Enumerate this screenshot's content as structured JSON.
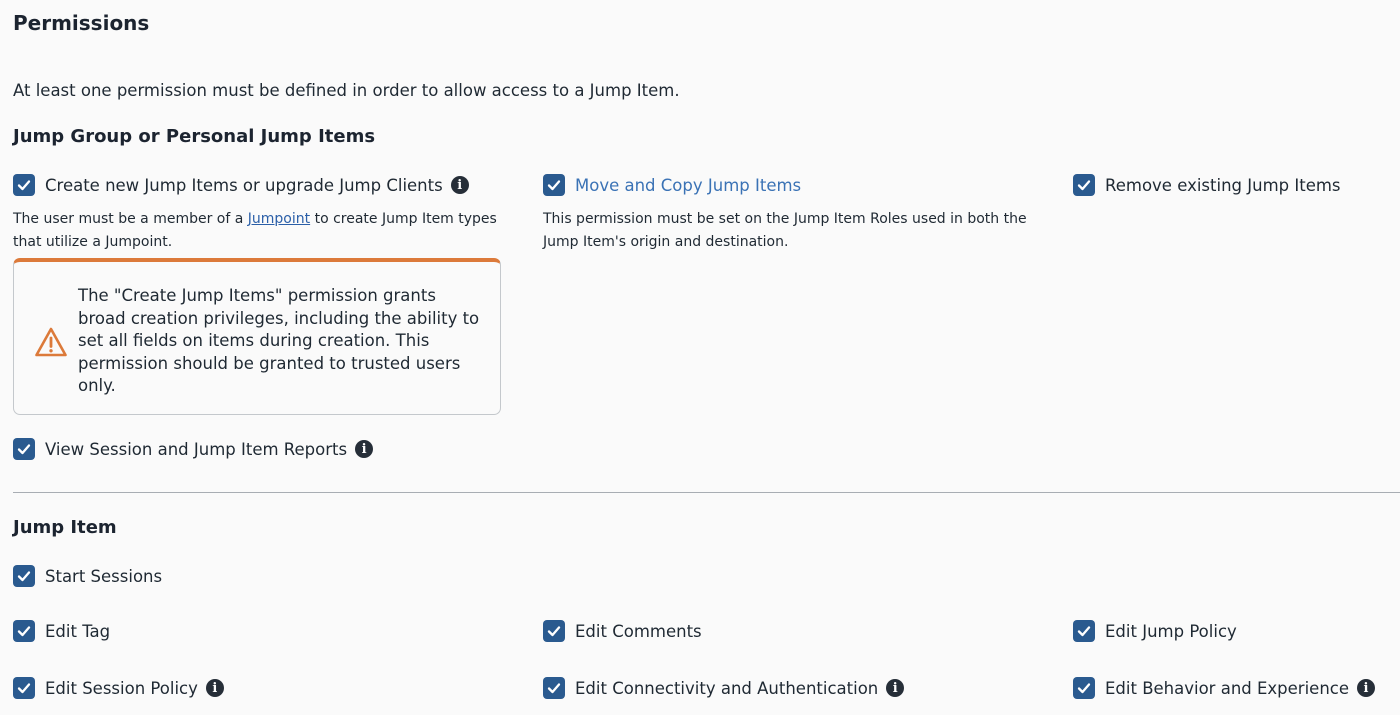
{
  "page": {
    "title": "Permissions",
    "intro": "At least one permission must be defined in order to allow access to a Jump Item."
  },
  "group_section": {
    "heading": "Jump Group or Personal Jump Items",
    "create": {
      "label": "Create new Jump Items or upgrade Jump Clients",
      "checked": true,
      "info_icon": "info-icon",
      "help_prefix": "The user must be a member of a ",
      "help_link": "Jumpoint",
      "help_suffix": " to create Jump Item types that utilize a Jumpoint."
    },
    "move": {
      "label": "Move and Copy Jump Items",
      "checked": true,
      "help": "This permission must be set on the Jump Item Roles used in both the Jump Item's origin and destination."
    },
    "remove": {
      "label": "Remove existing Jump Items",
      "checked": true
    },
    "warning": {
      "icon": "warning-triangle-icon",
      "text": "The \"Create Jump Items\" permission grants broad creation privileges, including the ability to set all fields on items during creation. This permission should be granted to trusted users only.",
      "color": "#dc7a3a"
    },
    "reports": {
      "label": "View Session and Jump Item Reports",
      "checked": true,
      "info_icon": "info-icon"
    }
  },
  "item_section": {
    "heading": "Jump Item",
    "start_sessions": "Start Sessions",
    "edit_tag": "Edit Tag",
    "edit_comments": "Edit Comments",
    "edit_jump_policy": "Edit Jump Policy",
    "edit_session_policy": "Edit Session Policy",
    "edit_connectivity": "Edit Connectivity and Authentication",
    "edit_behavior": "Edit Behavior and Experience"
  },
  "colors": {
    "checkbox": "#2a5a8f",
    "link": "#3a72b5",
    "accent_warning": "#dc7a3a"
  }
}
